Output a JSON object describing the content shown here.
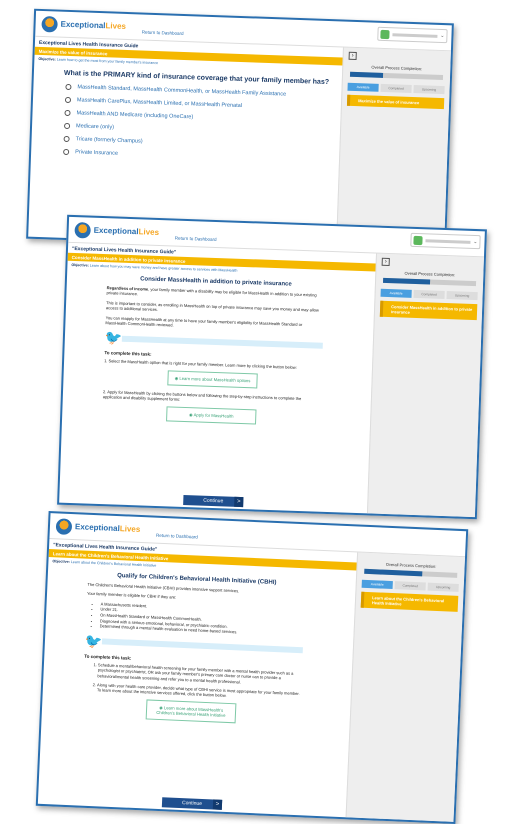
{
  "common": {
    "brand_a": "Exceptional",
    "brand_b": "Lives",
    "dashboard_link": "Return to Dashboard",
    "overall_label": "Overall Process Completion:",
    "tabs": [
      "Available",
      "Completed",
      "Upcoming"
    ],
    "continue_label": "Continue",
    "arrow": ">",
    "collapse_icon": "›",
    "caret": "⌄"
  },
  "s1": {
    "guide_title": "Exceptional Lives Health Insurance Guide",
    "yellow": "Maximize the value of insurance",
    "objective": "Objective:",
    "objective_text": "Learn how to get the most from your family member's insurance",
    "question": "What is the PRIMARY kind of insurance coverage that your family member has?",
    "options": [
      "MassHealth Standard, MassHealth CommonHealth, or MassHealth Family Assistance",
      "MassHealth CarePlus, MassHealth Limited, or MassHealth Prenatal",
      "MassHealth AND Medicare (including OneCare)",
      "Medicare (only)",
      "Tricare (formerly Champus)",
      "Private Insurance"
    ],
    "task_card": "Maximize the value of insurance",
    "progress": 0.35
  },
  "s2": {
    "guide_title": "\"Exceptional Lives Health Insurance Guide\"",
    "yellow": "Consider MassHealth in addition to private insurance",
    "objective": "Objective:",
    "objective_text": "Learn about how you may save money and have greater access to services with MassHealth",
    "heading": "Consider MassHealth in addition to private insurance",
    "p1_b": "Regardless of income",
    "p1": ", your family member with a disability may be eligible for MassHealth in addition to your existing private insurance.",
    "p2": "This is important to consider, as enrolling in MassHealth on top of private insurance may save you money and may allow access to additional services.",
    "p3": "You can reapply for MassHealth at any time to have your family member's eligibility for MassHealth Standard or MassHealth CommonHealth reviewed.",
    "task_heading": "To complete this task:",
    "step1": "1. Select the MassHealth option that is right for your family member. Learn more by clicking the button below:",
    "btn1": "Learn more about MassHealth options",
    "step2": "2. Apply for MassHealth by clicking the buttons below and following the step-by-step instructions to complete the application and disability supplement forms:",
    "btn2": "Apply for MassHealth",
    "task_card": "Consider MassHealth in addition to private insurance",
    "progress": 0.5
  },
  "s3": {
    "guide_title": "\"Exceptional Lives Health Insurance Guide\"",
    "yellow": "Learn about the Children's Behavioral Health Initiative",
    "objective": "Objective:",
    "objective_text": "Learn about the Children's Behavioral Health Initiative",
    "heading": "Qualify for Children's Behavioral Health Initiative (CBHI)",
    "p1": "The Children's Behavioral Health Initiative (CBHI) provides intensive support services.",
    "p2": "Your family member is eligible for CBHI if they are:",
    "bullets": [
      "A Massachusetts resident.",
      "Under 21.",
      "On MassHealth Standard or MassHealth CommonHealth.",
      "Diagnosed with a serious emotional, behavioral, or psychiatric condition.",
      "Determined through a mental health evaluation to need home-based services."
    ],
    "task_heading": "To complete this task:",
    "steps": [
      "Schedule a mental/behavioral health screening for your family member with a mental health provider such as a psychologist or psychiatrist, OR ask your family member's primary care doctor or nurse can to provide a behavioral/mental health screening and refer you to a mental health professional.",
      "Along with your health care provider, decide what type of CBHI service is most appropriate for your family member. To learn more about the intensive services offered, click the button below."
    ],
    "btn1": "Learn more about MassHealth's Children's Behavioral Health Initiative",
    "task_card": "Learn about the Children's Behavioral Health Initiative",
    "progress": 0.62
  }
}
